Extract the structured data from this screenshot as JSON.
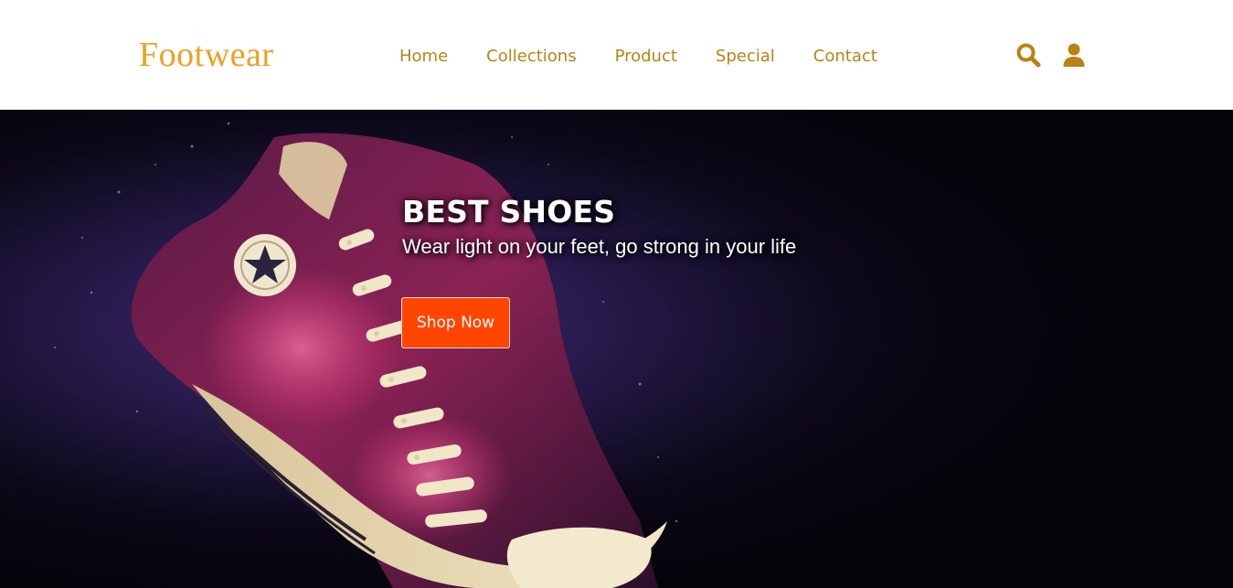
{
  "brand": {
    "logo_text": "Footwear",
    "logo_color": "#f0a020"
  },
  "nav": {
    "color": "#b98314",
    "items": [
      {
        "label": "Home"
      },
      {
        "label": "Collections"
      },
      {
        "label": "Product"
      },
      {
        "label": "Special"
      },
      {
        "label": "Contact"
      }
    ]
  },
  "header_icons": {
    "search": "search-icon",
    "user": "user-icon"
  },
  "hero": {
    "title": "BEST SHOES",
    "subtitle": "Wear light on your feet, go strong in your life",
    "cta_label": "Shop Now",
    "cta_color": "#ff4500",
    "image": "sneaker-splash-image"
  }
}
